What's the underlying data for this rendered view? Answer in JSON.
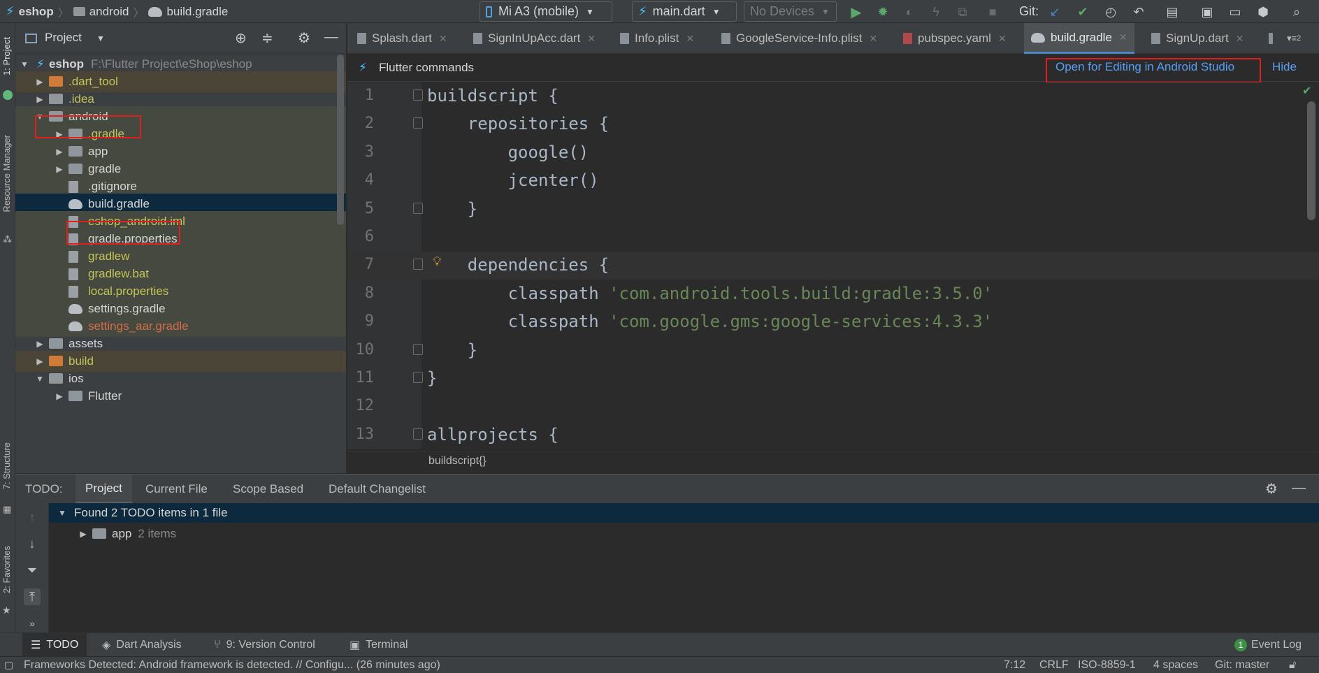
{
  "breadcrumb": [
    "eshop",
    "android",
    "build.gradle"
  ],
  "toolbar": {
    "device": "Mi A3 (mobile)",
    "run_config": "main.dart",
    "devices_combo": "No Devices",
    "git_label": "Git:"
  },
  "project_panel": {
    "title": "Project",
    "root_name": "eshop",
    "root_path": "F:\\Flutter Project\\eShop\\eshop",
    "items": [
      {
        "label": ".dart_tool"
      },
      {
        "label": ".idea"
      },
      {
        "label": "android"
      },
      {
        "label": ".gradle"
      },
      {
        "label": "app"
      },
      {
        "label": "gradle"
      },
      {
        "label": ".gitignore"
      },
      {
        "label": "build.gradle"
      },
      {
        "label": "eshop_android.iml"
      },
      {
        "label": "gradle.properties"
      },
      {
        "label": "gradlew"
      },
      {
        "label": "gradlew.bat"
      },
      {
        "label": "local.properties"
      },
      {
        "label": "settings.gradle"
      },
      {
        "label": "settings_aar.gradle"
      },
      {
        "label": "assets"
      },
      {
        "label": "build"
      },
      {
        "label": "ios"
      },
      {
        "label": "Flutter"
      }
    ]
  },
  "editor_tabs": [
    {
      "label": "Splash.dart"
    },
    {
      "label": "SignInUpAcc.dart"
    },
    {
      "label": "Info.plist"
    },
    {
      "label": "GoogleService-Info.plist"
    },
    {
      "label": "pubspec.yaml"
    },
    {
      "label": "build.gradle"
    },
    {
      "label": "SignUp.dart"
    }
  ],
  "tab_overflow": "2",
  "notice_bar": {
    "title": "Flutter commands",
    "open_link": "Open for Editing in Android Studio",
    "hide_link": "Hide"
  },
  "code": {
    "lines": [
      {
        "n": "1",
        "text": "buildscript {",
        "str": ""
      },
      {
        "n": "2",
        "text": "    repositories {",
        "str": ""
      },
      {
        "n": "3",
        "text": "        google()",
        "str": ""
      },
      {
        "n": "4",
        "text": "        jcenter()",
        "str": ""
      },
      {
        "n": "5",
        "text": "    }",
        "str": ""
      },
      {
        "n": "6",
        "text": "",
        "str": ""
      },
      {
        "n": "7",
        "text": "    dependencies {",
        "str": ""
      },
      {
        "n": "8",
        "text": "        classpath ",
        "str": "'com.android.tools.build:gradle:3.5.0'"
      },
      {
        "n": "9",
        "text": "        classpath ",
        "str": "'com.google.gms:google-services:4.3.3'"
      },
      {
        "n": "10",
        "text": "    }",
        "str": ""
      },
      {
        "n": "11",
        "text": "}",
        "str": ""
      },
      {
        "n": "12",
        "text": "",
        "str": ""
      },
      {
        "n": "13",
        "text": "allprojects {",
        "str": ""
      }
    ]
  },
  "editor_breadcrumb": "buildscript{}",
  "todo_panel": {
    "label": "TODO:",
    "tabs": [
      "Project",
      "Current File",
      "Scope Based",
      "Default Changelist"
    ],
    "summary": "Found 2 TODO items in 1 file",
    "node_label": "app",
    "node_count": "2 items"
  },
  "left_stripe": {
    "project": "1: Project",
    "resource_manager": "Resource Manager",
    "structure": "7: Structure",
    "favorites": "2: Favorites"
  },
  "bottom_tabs": {
    "todo": "TODO",
    "dart_analysis": "Dart Analysis",
    "version_control": "9: Version Control",
    "terminal": "Terminal",
    "event_log": "Event Log",
    "event_count": "1"
  },
  "status": {
    "message": "Frameworks Detected: Android framework is detected. // Configu... (26 minutes ago)",
    "position": "7:12",
    "line_sep": "CRLF",
    "encoding": "ISO-8859-1",
    "indent": "4 spaces",
    "git": "Git: master"
  },
  "colors": {
    "accent": "#4a88c7",
    "highlight_box": "#e02020",
    "selection": "#0d293e",
    "string": "#6a8759",
    "link": "#589df6"
  }
}
